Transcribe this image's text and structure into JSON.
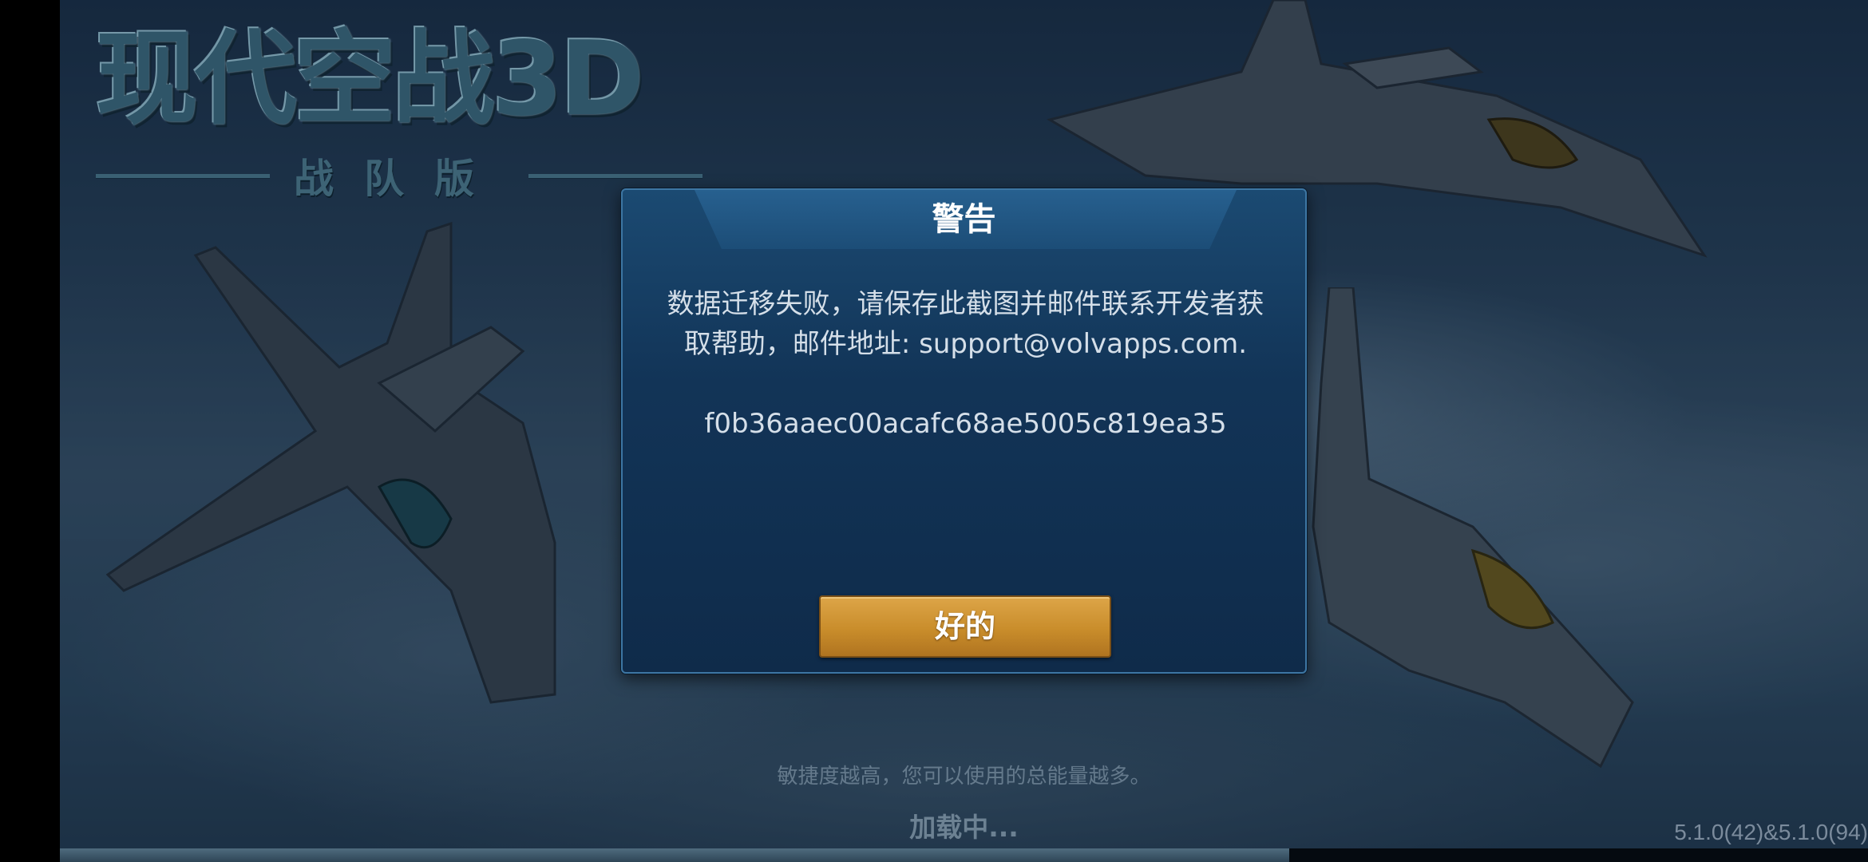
{
  "game": {
    "logo_title": "现代空战3D",
    "logo_subtitle": "战队版",
    "hint": "敏捷度越高，您可以使用的总能量越多。",
    "loading": "加载中...",
    "version": "5.1.0(42)&5.1.0(94)",
    "load_progress_percent": 68
  },
  "dialog": {
    "title": "警告",
    "message": "数据迁移失败，请保存此截图并邮件联系开发者获取帮助，邮件地址: support@volvapps.com.",
    "code": "f0b36aaec00acafc68ae5005c819ea35",
    "ok_label": "好的"
  },
  "colors": {
    "dialog_bg": "#123457",
    "dialog_border": "#3d76a3",
    "button_gold": "#c98d2b"
  }
}
